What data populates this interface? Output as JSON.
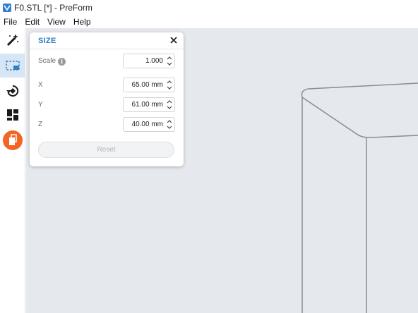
{
  "window": {
    "title": "F0.STL [*] - PreForm"
  },
  "menu": {
    "items": [
      "File",
      "Edit",
      "View",
      "Help"
    ]
  },
  "toolbar": {
    "tools": [
      {
        "icon": "magic-wand-icon"
      },
      {
        "icon": "scale-icon",
        "active": true
      },
      {
        "icon": "orient-icon"
      },
      {
        "icon": "layout-icon"
      },
      {
        "icon": "supports-icon",
        "accent": "#f26522"
      }
    ]
  },
  "size_panel": {
    "title": "SIZE",
    "scale_label": "Scale",
    "scale_value": "1.000",
    "x_label": "X",
    "x_value": "65.00 mm",
    "y_label": "Y",
    "y_value": "61.00 mm",
    "z_label": "Z",
    "z_value": "40.00 mm",
    "reset_label": "Reset"
  },
  "colors": {
    "accent": "#2f7fc4",
    "viewport": "#e5e8ec",
    "active_tool": "#d6e6f5",
    "supports": "#f26522"
  }
}
